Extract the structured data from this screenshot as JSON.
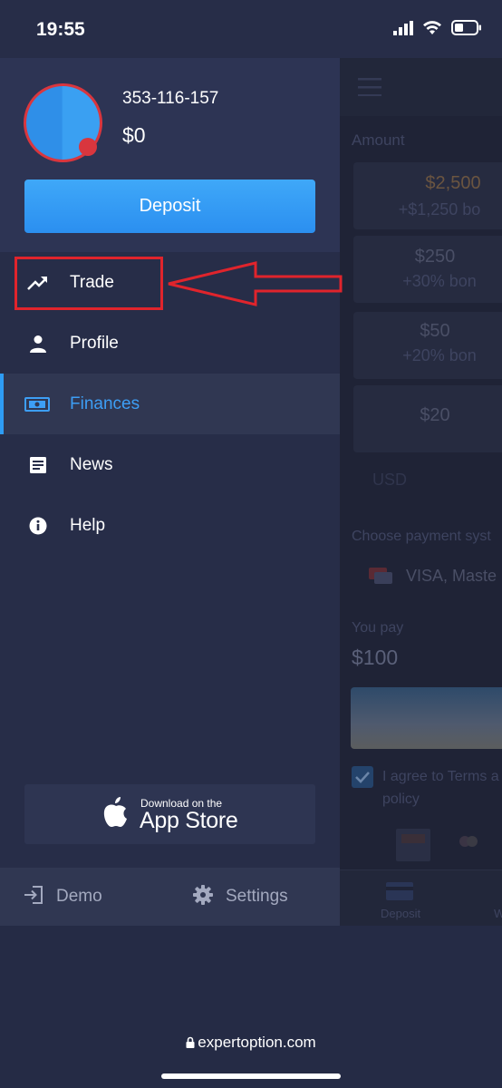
{
  "status_bar": {
    "time": "19:55",
    "icons": [
      "signal-icon",
      "wifi-icon",
      "battery-icon"
    ]
  },
  "drawer": {
    "account_id": "353-116-157",
    "balance": "$0",
    "deposit_label": "Deposit",
    "menu": [
      {
        "label": "Trade",
        "icon": "trend-up-icon"
      },
      {
        "label": "Profile",
        "icon": "user-icon"
      },
      {
        "label": "Finances",
        "icon": "money-icon",
        "active": true
      },
      {
        "label": "News",
        "icon": "news-icon"
      },
      {
        "label": "Help",
        "icon": "info-icon"
      }
    ],
    "appstore": {
      "small": "Download on the",
      "big": "App Store"
    },
    "bottom": {
      "demo": "Demo",
      "settings": "Settings"
    }
  },
  "background": {
    "amount_label": "Amount",
    "cards": [
      {
        "value": "$2,500",
        "bonus": "+$1,250 bo"
      },
      {
        "value": "$250",
        "bonus": "+30% bon"
      },
      {
        "value": "$50",
        "bonus": "+20% bon"
      },
      {
        "value": "$20",
        "bonus": ""
      }
    ],
    "currency": "USD",
    "choose_payment": "Choose payment syst",
    "payment_method": "VISA, Maste",
    "you_pay_label": "You pay",
    "you_pay_value": "$100",
    "agree_text": "I agree to Terms a",
    "agree_text2": "policy",
    "tab_deposit": "Deposit",
    "tab_w": "W"
  },
  "browser": {
    "url": "expertoption.com"
  },
  "colors": {
    "accent": "#2e9cf4",
    "annotation": "#e0242c",
    "drawer_bg": "#272d48"
  }
}
